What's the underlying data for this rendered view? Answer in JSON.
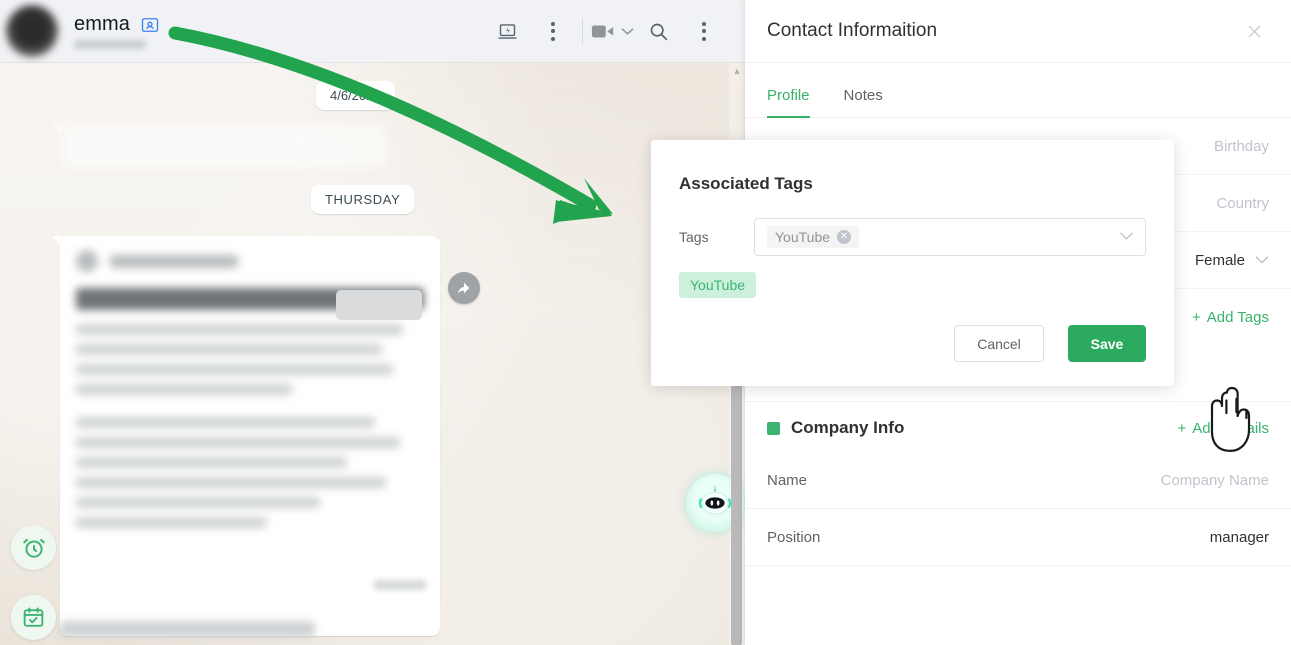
{
  "chat": {
    "contact_name": "emma",
    "contact_card_icon": "contact-card-icon",
    "toolbar": [
      {
        "icon": "laptop-bolt-icon"
      },
      {
        "icon": "more-vertical-icon"
      },
      {
        "icon": "video-camera-icon"
      },
      {
        "icon": "chevron-down-icon"
      },
      {
        "icon": "search-icon"
      },
      {
        "icon": "more-vertical-icon"
      }
    ],
    "date_pill": "4/6/2024",
    "day_pill": "THURSDAY",
    "share_icon": "forward-arrow-icon",
    "bot_icon": "robot-assistant-icon",
    "fab_clock_icon": "alarm-clock-icon",
    "fab_calendar_icon": "calendar-check-icon",
    "annotation": {
      "type": "curved-arrow",
      "color": "#22A44E"
    }
  },
  "panel": {
    "title": "Contact Informaition",
    "close_icon": "close-icon",
    "tabs": [
      {
        "label": "Profile",
        "active": true
      },
      {
        "label": "Notes",
        "active": false
      }
    ],
    "fields": [
      {
        "label": "Birthday",
        "value": "Birthday",
        "placeholder": true
      },
      {
        "label": "Country",
        "value": "Country",
        "placeholder": true
      },
      {
        "label": "Gender",
        "value": "Female",
        "placeholder": false,
        "chevron": true
      }
    ],
    "tags_section": {
      "add_link": "Add Tags",
      "add_icon": "plus-icon",
      "tags": [
        {
          "label": "YouTube",
          "remove_icon": "close-icon"
        }
      ]
    },
    "company_section": {
      "title": "Company Info",
      "marker_icon": "green-square-icon",
      "add_link": "Add Details",
      "add_icon": "plus-icon",
      "rows": [
        {
          "label": "Name",
          "value": "Company Name",
          "placeholder": true
        },
        {
          "label": "Position",
          "value": "manager",
          "placeholder": false
        }
      ]
    }
  },
  "modal": {
    "title": "Associated Tags",
    "tags_label": "Tags",
    "selected_tag": "YouTube",
    "selected_tag_remove_icon": "close-circle-icon",
    "dropdown_icon": "chevron-down-icon",
    "suggested_tag": "YouTube",
    "cancel_label": "Cancel",
    "save_label": "Save"
  },
  "cursor": {
    "icon": "pointing-hand-cursor"
  },
  "colors": {
    "brand_green": "#3CB371",
    "save_green": "#2CAB60",
    "annotation_green": "#22A44E",
    "tag_bg": "#E4F7EC",
    "chat_bg": "#ECE5DD",
    "header_bg": "#F0F2F5"
  }
}
